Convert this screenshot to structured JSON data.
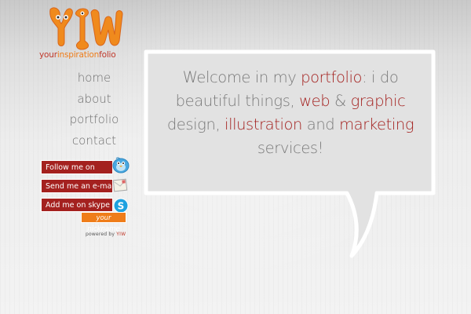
{
  "logo": {
    "mark": "YIW",
    "text_part1": "your",
    "text_part2": "inspiration",
    "text_part3": "folio"
  },
  "nav": {
    "items": [
      {
        "label": "home"
      },
      {
        "label": "about"
      },
      {
        "label": "portfolio"
      },
      {
        "label": "contact"
      }
    ]
  },
  "social": {
    "follow_label": "Follow me on",
    "email_label": "Send me an e-mail",
    "skype_label": "Add me on skype",
    "nickname": "your nickname",
    "icons": [
      "twitter-icon",
      "mail-icon",
      "skype-icon"
    ]
  },
  "footer": {
    "powered_by": "powered by",
    "powered_brand": "YIW"
  },
  "welcome": {
    "t1": "Welcome in my ",
    "h1": "portfolio",
    "t2": ": i do beautiful things, ",
    "h2": "web",
    "t3": " & ",
    "h3": "graphic",
    "t4": " design, ",
    "h4": "illustration",
    "t5": " and ",
    "h5": "marketing",
    "t6": " services!"
  },
  "colors": {
    "accent_red": "#a4211f",
    "accent_orange": "#ef7d1a",
    "nav_text": "#6f6f6f",
    "bubble_fill": "#e2e2e2"
  }
}
